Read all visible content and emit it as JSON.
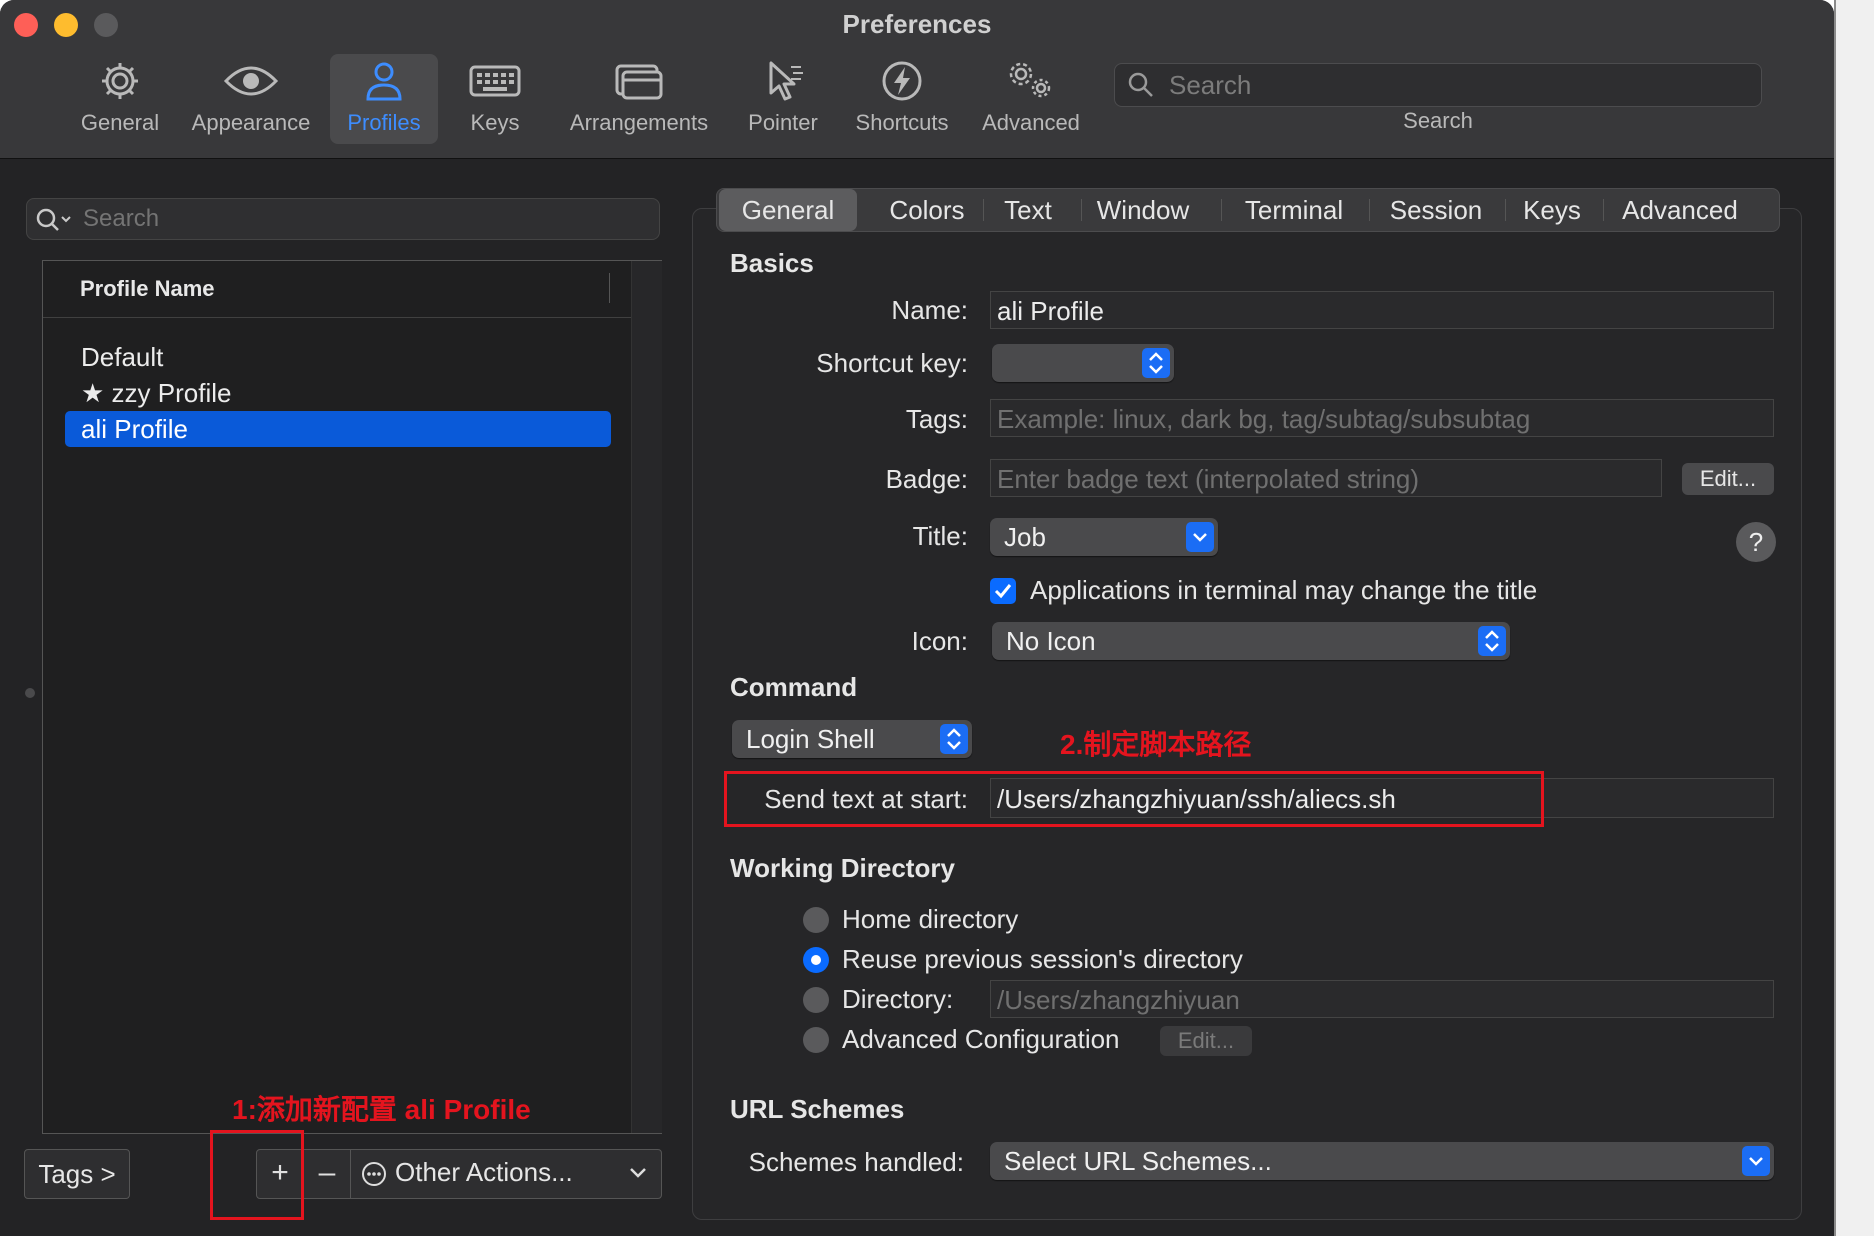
{
  "window": {
    "title": "Preferences"
  },
  "toolbar": {
    "items": [
      {
        "label": "General",
        "icon": "gear-icon"
      },
      {
        "label": "Appearance",
        "icon": "eye-icon"
      },
      {
        "label": "Profiles",
        "icon": "person-icon",
        "selected": true
      },
      {
        "label": "Keys",
        "icon": "keyboard-icon"
      },
      {
        "label": "Arrangements",
        "icon": "window-stack-icon"
      },
      {
        "label": "Pointer",
        "icon": "pointer-icon"
      },
      {
        "label": "Shortcuts",
        "icon": "lightning-icon"
      },
      {
        "label": "Advanced",
        "icon": "gears-icon"
      }
    ],
    "search_placeholder": "Search",
    "search_caption": "Search"
  },
  "sidebar": {
    "search_placeholder": "Search",
    "column_header": "Profile Name",
    "profiles": [
      {
        "name": "Default",
        "default": false,
        "selected": false
      },
      {
        "name": "zzy Profile",
        "default": true,
        "selected": false
      },
      {
        "name": "ali Profile",
        "default": false,
        "selected": true
      }
    ],
    "tags_button": "Tags >",
    "add_button": "+",
    "remove_button": "–",
    "other_actions": "Other Actions..."
  },
  "tabs": [
    "General",
    "Colors",
    "Text",
    "Window",
    "Terminal",
    "Session",
    "Keys",
    "Advanced"
  ],
  "active_tab": "General",
  "basics": {
    "heading": "Basics",
    "name_label": "Name:",
    "name_value": "ali Profile",
    "shortcut_label": "Shortcut key:",
    "shortcut_value": "",
    "tags_label": "Tags:",
    "tags_placeholder": "Example: linux, dark bg, tag/subtag/subsubtag",
    "badge_label": "Badge:",
    "badge_placeholder": "Enter badge text (interpolated string)",
    "badge_edit": "Edit...",
    "title_label": "Title:",
    "title_value": "Job",
    "help": "?",
    "apps_change_title": "Applications in terminal may change the title",
    "apps_change_title_checked": true,
    "icon_label": "Icon:",
    "icon_value": "No Icon"
  },
  "command": {
    "heading": "Command",
    "mode": "Login Shell",
    "send_text_label": "Send text at start:",
    "send_text_value": "/Users/zhangzhiyuan/ssh/aliecs.sh"
  },
  "working_directory": {
    "heading": "Working Directory",
    "options": [
      {
        "label": "Home directory",
        "selected": false
      },
      {
        "label": "Reuse previous session's directory",
        "selected": true
      },
      {
        "label": "Directory:",
        "selected": false
      },
      {
        "label": "Advanced Configuration",
        "selected": false
      }
    ],
    "directory_placeholder": "/Users/zhangzhiyuan",
    "advanced_edit": "Edit..."
  },
  "url_schemes": {
    "heading": "URL Schemes",
    "label": "Schemes handled:",
    "value": "Select URL Schemes..."
  },
  "annotations": {
    "step1": "1:添加新配置 ali Profile",
    "step2": "2.制定脚本路径"
  },
  "colors": {
    "accent": "#0a6bff",
    "selection": "#0a5ad9",
    "annotation": "#e4141e",
    "traffic_red": "#fe5f57",
    "traffic_yellow": "#febc2e",
    "traffic_inactive": "#5a5a5c"
  }
}
